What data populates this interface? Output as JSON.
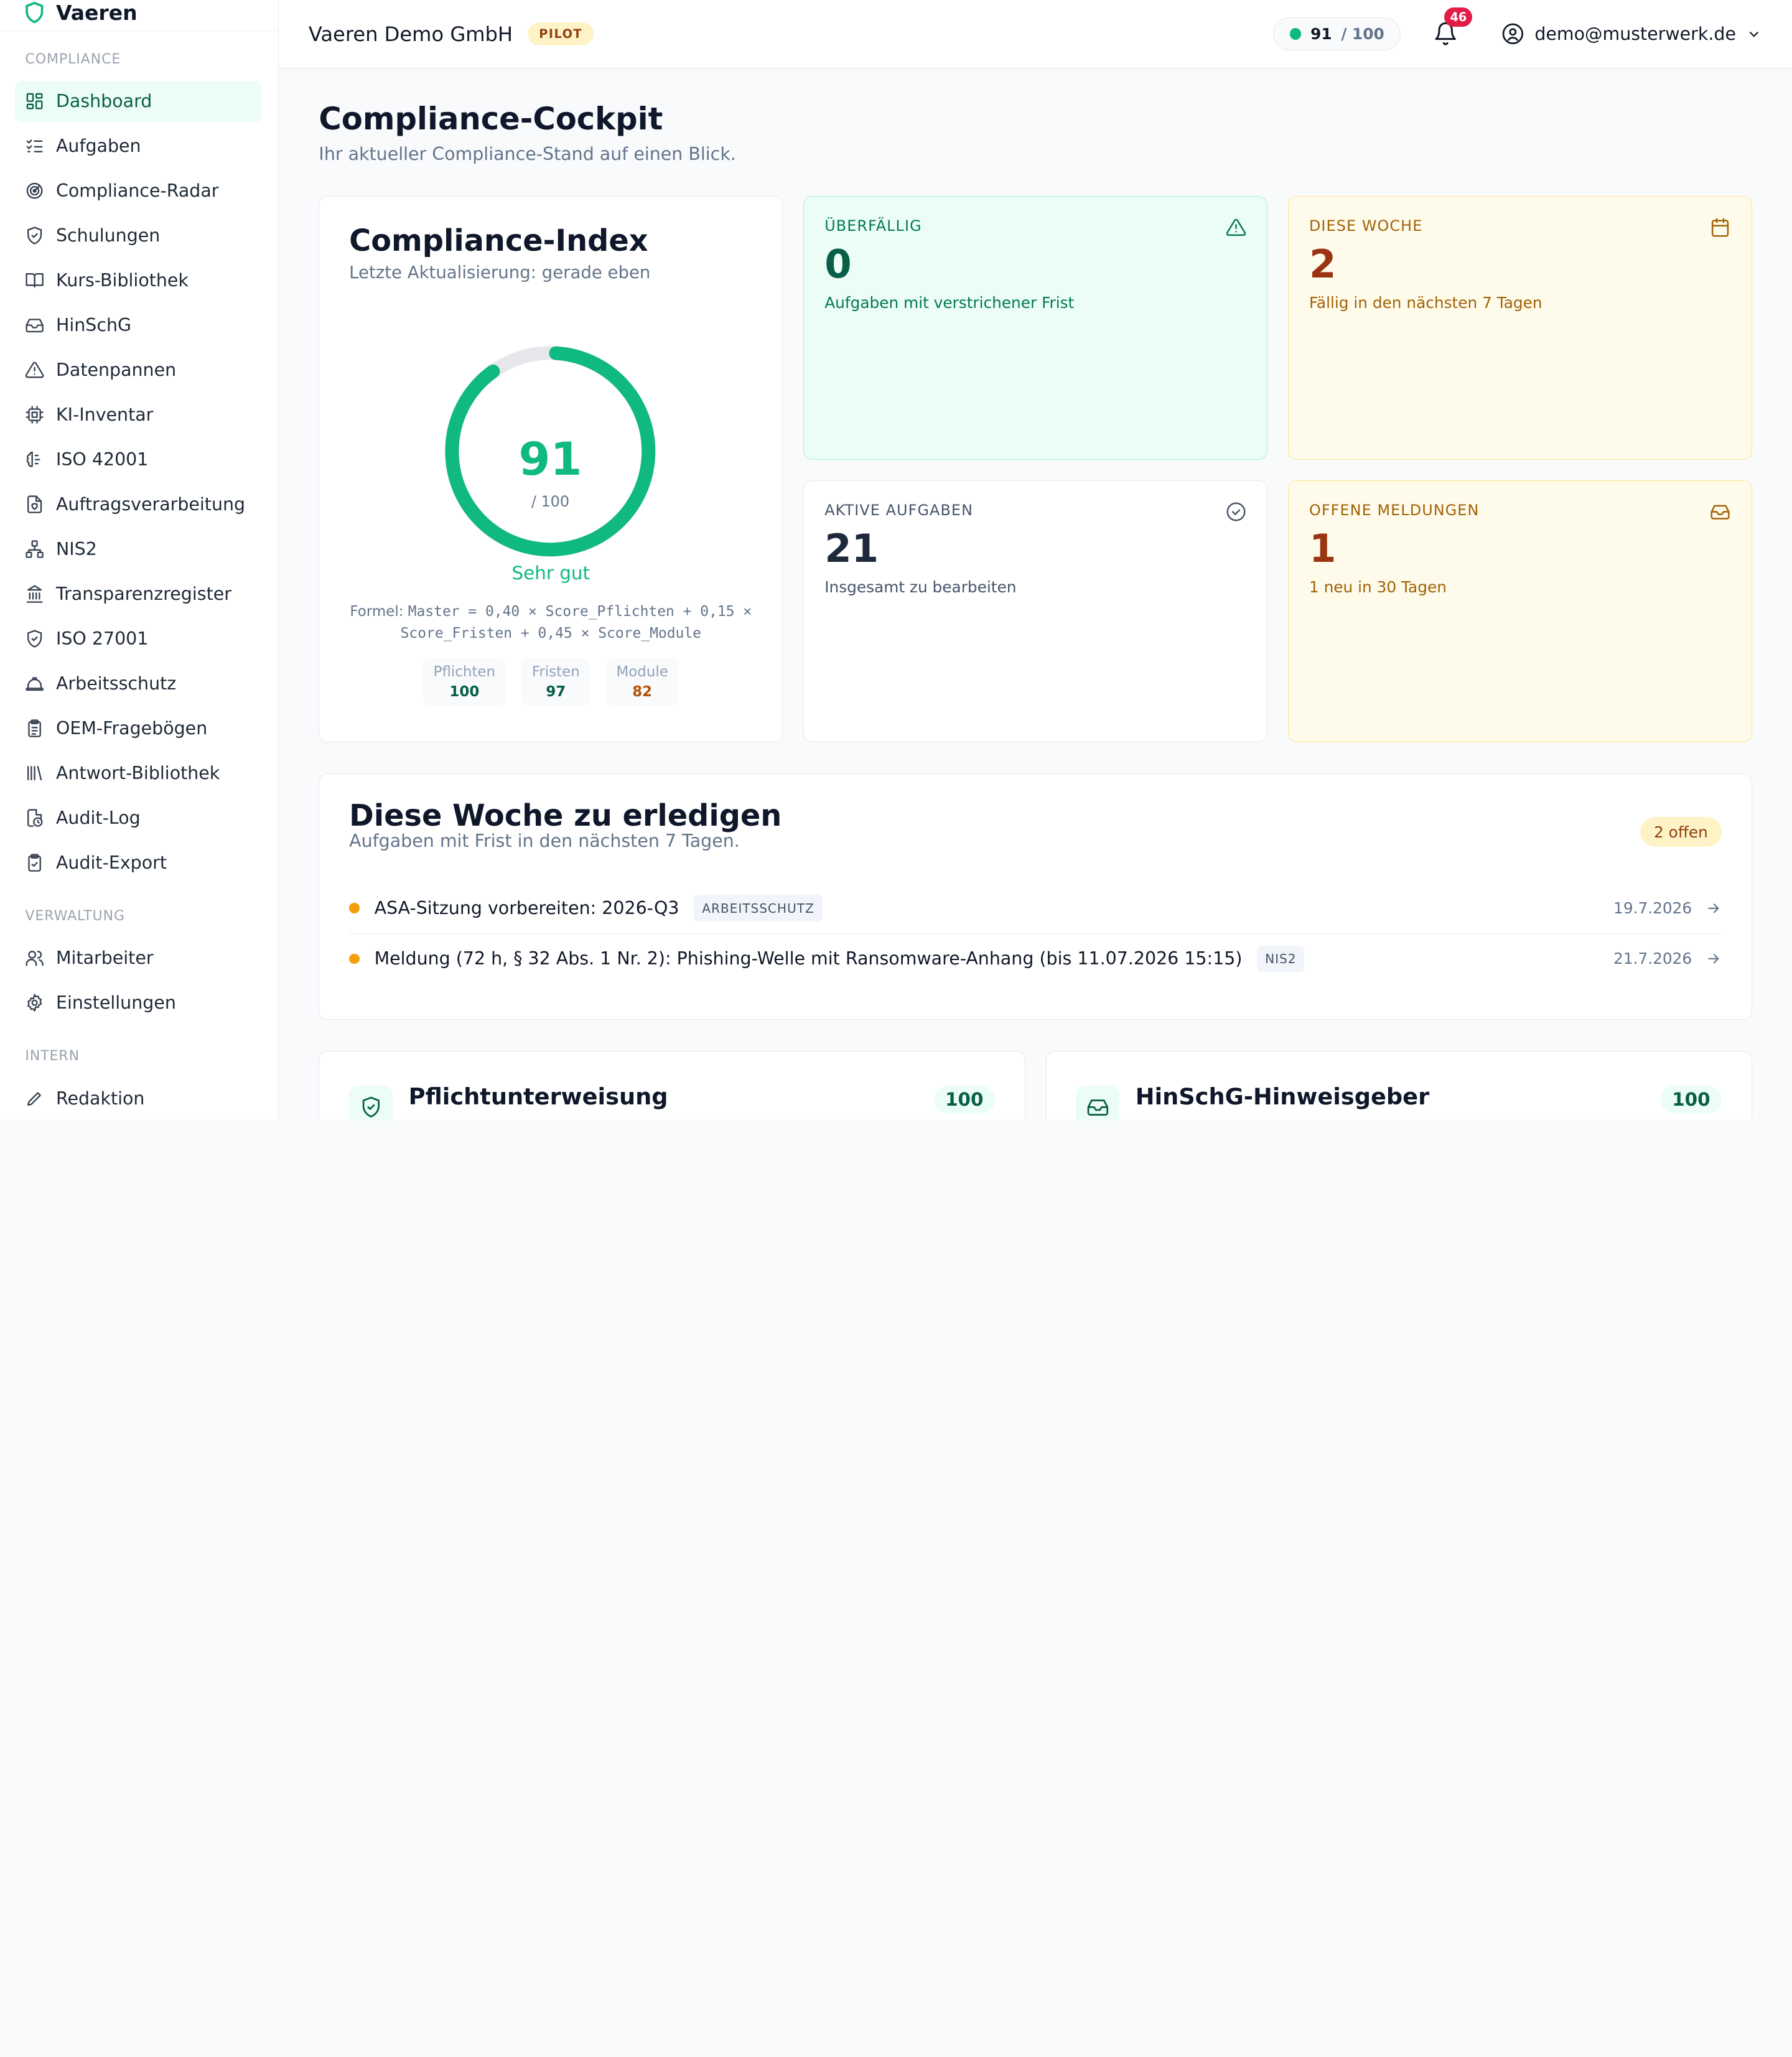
{
  "brand": {
    "name": "Vaeren"
  },
  "sidebar": {
    "sections": [
      {
        "label": "COMPLIANCE",
        "items": [
          {
            "label": "Dashboard",
            "icon": "dashboard-icon",
            "active": true
          },
          {
            "label": "Aufgaben",
            "icon": "list-checks-icon"
          },
          {
            "label": "Compliance-Radar",
            "icon": "radar-icon"
          },
          {
            "label": "Schulungen",
            "icon": "shield-check-icon"
          },
          {
            "label": "Kurs-Bibliothek",
            "icon": "book-open-icon"
          },
          {
            "label": "HinSchG",
            "icon": "inbox-icon"
          },
          {
            "label": "Datenpannen",
            "icon": "alert-triangle-icon"
          },
          {
            "label": "KI-Inventar",
            "icon": "cpu-icon"
          },
          {
            "label": "ISO 42001",
            "icon": "brain-icon"
          },
          {
            "label": "Auftragsverarbeitung",
            "icon": "file-shield-icon"
          },
          {
            "label": "NIS2",
            "icon": "network-icon"
          },
          {
            "label": "Transparenzregister",
            "icon": "landmark-icon"
          },
          {
            "label": "ISO 27001",
            "icon": "shield-check-icon"
          },
          {
            "label": "Arbeitsschutz",
            "icon": "hard-hat-icon"
          },
          {
            "label": "OEM-Fragebögen",
            "icon": "clipboard-list-icon"
          },
          {
            "label": "Antwort-Bibliothek",
            "icon": "library-icon"
          },
          {
            "label": "Audit-Log",
            "icon": "file-clock-icon"
          },
          {
            "label": "Audit-Export",
            "icon": "clipboard-check-icon"
          }
        ]
      },
      {
        "label": "VERWALTUNG",
        "items": [
          {
            "label": "Mitarbeiter",
            "icon": "users-icon"
          },
          {
            "label": "Einstellungen",
            "icon": "gear-icon"
          }
        ]
      },
      {
        "label": "INTERN",
        "items": [
          {
            "label": "Redaktion",
            "icon": "pen-icon"
          }
        ]
      }
    ]
  },
  "topbar": {
    "org_name": "Vaeren Demo GmbH",
    "badge": "PILOT",
    "score": "91",
    "score_max": "/ 100",
    "notifications": "46",
    "user_email": "demo@musterwerk.de"
  },
  "page": {
    "title": "Compliance-Cockpit",
    "subtitle": "Ihr aktueller Compliance-Stand auf einen Blick."
  },
  "index_card": {
    "title": "Compliance-Index",
    "subtitle": "Letzte Aktualisierung: gerade eben",
    "score": "91",
    "score_max": "/ 100",
    "score_fraction": 0.91,
    "rating": "Sehr gut",
    "formula_prefix": "Formel:",
    "formula": "Master = 0,40 × Score_Pflichten + 0,15 × Score_Fristen + 0,45 × Score_Module",
    "subscores": [
      {
        "label": "Pflichten",
        "value": "100",
        "color": "#065f46"
      },
      {
        "label": "Fristen",
        "value": "97",
        "color": "#065f46"
      },
      {
        "label": "Module",
        "value": "82",
        "color": "#b45309"
      }
    ]
  },
  "stats": [
    {
      "label": "ÜBERFÄLLIG",
      "value": "0",
      "desc": "Aufgaben mit verstrichener Frist",
      "variant": "green",
      "icon": "alert-triangle-icon",
      "label_color": "#047857",
      "value_color": "#065f46"
    },
    {
      "label": "DIESE WOCHE",
      "value": "2",
      "desc": "Fällig in den nächsten 7 Tagen",
      "variant": "amber",
      "icon": "calendar-icon",
      "label_color": "#a16207",
      "value_color": "#9a3412"
    },
    {
      "label": "AKTIVE AUFGABEN",
      "value": "21",
      "desc": "Insgesamt zu bearbeiten",
      "variant": "white",
      "icon": "check-circle-icon",
      "label_color": "#475569",
      "value_color": "#1e293b"
    },
    {
      "label": "OFFENE MELDUNGEN",
      "value": "1",
      "desc": "1 neu in 30 Tagen",
      "variant": "amber",
      "icon": "inbox-icon",
      "label_color": "#a16207",
      "value_color": "#9a3412"
    }
  ],
  "week": {
    "title": "Diese Woche zu erledigen",
    "subtitle": "Aufgaben mit Frist in den nächsten 7 Tagen.",
    "badge": "2 offen",
    "tasks": [
      {
        "title": "ASA-Sitzung vorbereiten: 2026-Q3",
        "tag": "ARBEITSSCHUTZ",
        "date": "19.7.2026"
      },
      {
        "title": "Meldung (72 h, § 32 Abs. 1 Nr. 2): Phishing-Welle mit Ransomware-Anhang (bis 11.07.2026 15:15)",
        "tag": "NIS2",
        "date": "21.7.2026"
      }
    ]
  },
  "modules": [
    {
      "title": "Pflichtunterweisung",
      "score": "100",
      "icon": "shield-check-icon"
    },
    {
      "title": "HinSchG-Hinweisgeber",
      "score": "100",
      "icon": "inbox-icon"
    }
  ],
  "colors": {
    "accent": "#10b981",
    "amber": "#f59e0b",
    "danger": "#e11d48"
  }
}
